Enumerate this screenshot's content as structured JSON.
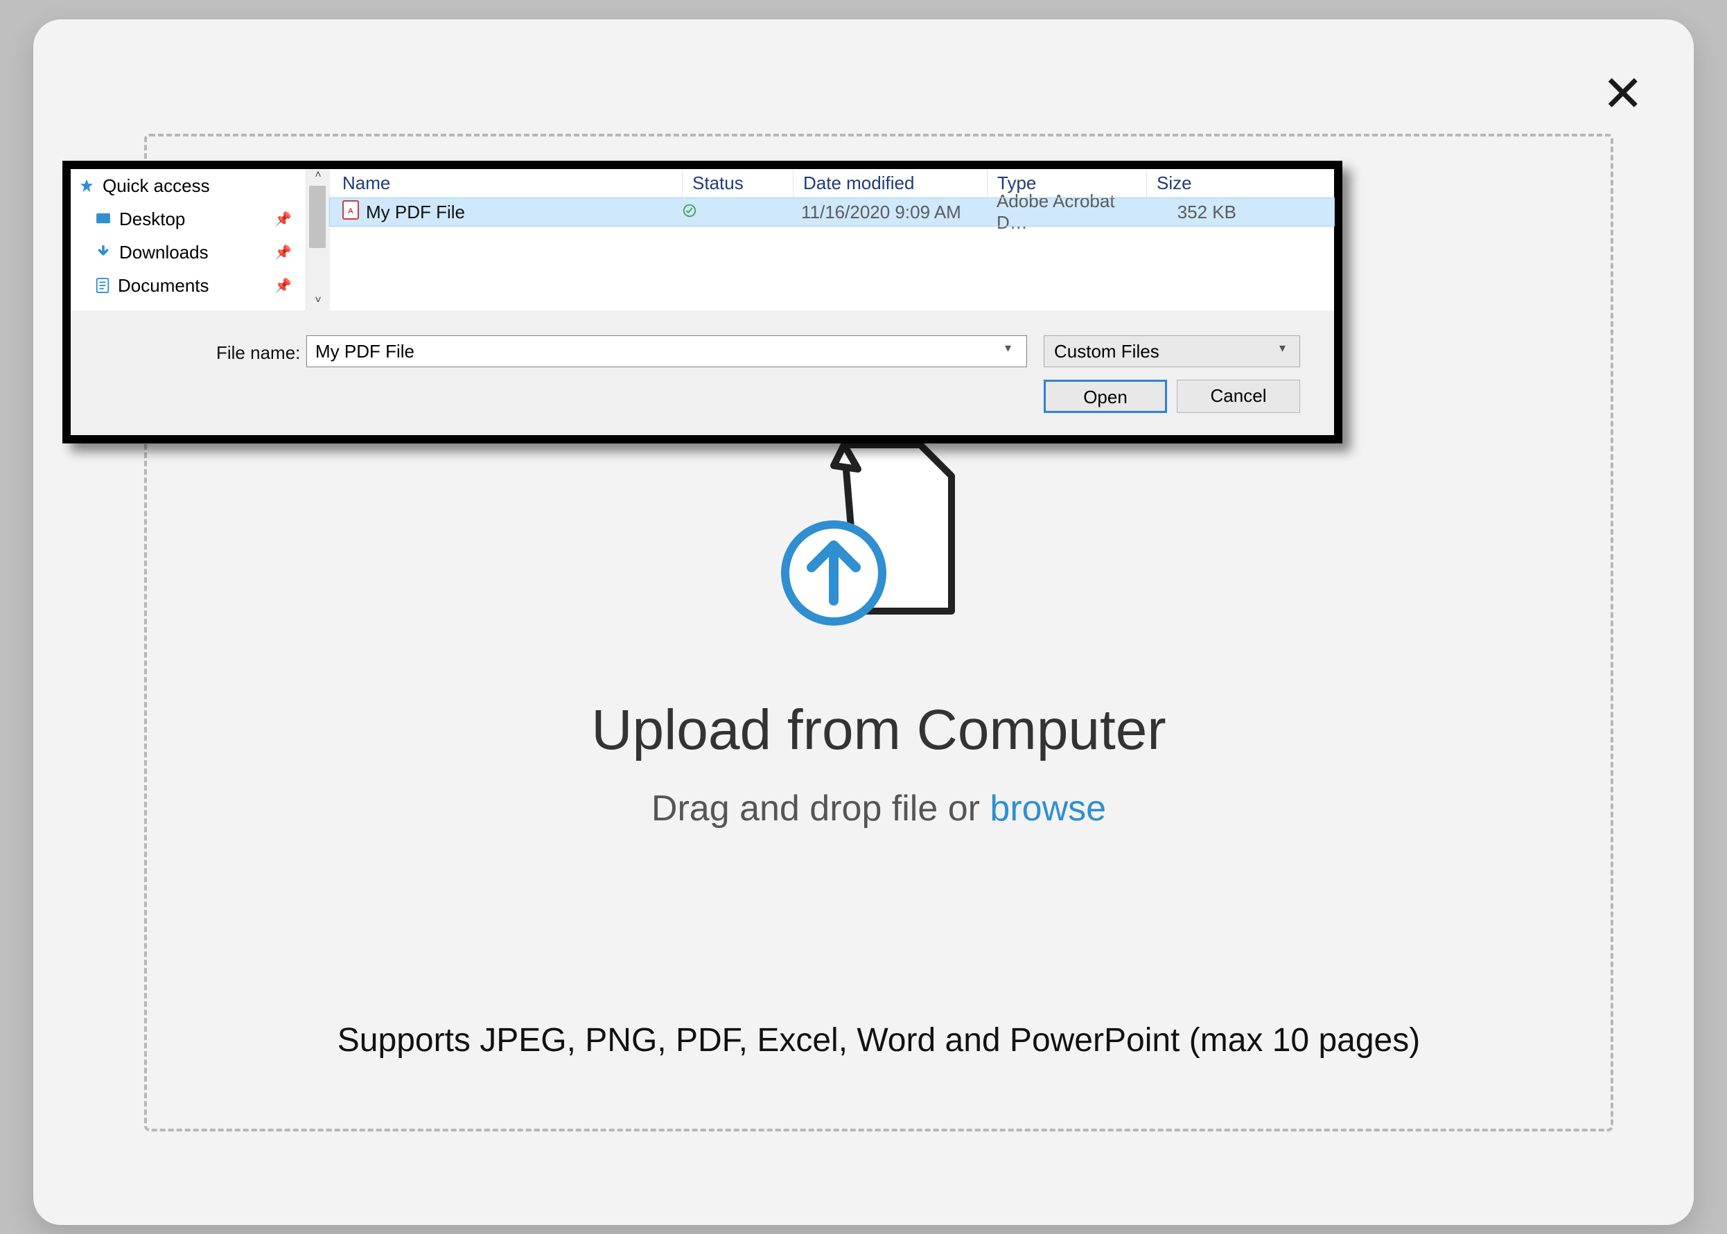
{
  "modal": {
    "headline": "Upload from Computer",
    "subline_prefix": "Drag and drop file or ",
    "subline_link": "browse",
    "supports": "Supports JPEG, PNG, PDF, Excel, Word and PowerPoint (max 10 pages)"
  },
  "picker": {
    "sidebar": {
      "quick_access": "Quick access",
      "items": [
        {
          "label": "Desktop",
          "icon": "desktop"
        },
        {
          "label": "Downloads",
          "icon": "download"
        },
        {
          "label": "Documents",
          "icon": "document"
        }
      ]
    },
    "columns": {
      "name": "Name",
      "status": "Status",
      "date": "Date modified",
      "type": "Type",
      "size": "Size"
    },
    "rows": [
      {
        "name": "My PDF File",
        "status_ok": true,
        "date": "11/16/2020 9:09 AM",
        "type": "Adobe Acrobat D…",
        "size": "352 KB",
        "selected": true
      }
    ],
    "file_name_label": "File name:",
    "file_name_value": "My PDF File",
    "filter_value": "Custom Files",
    "open_label": "Open",
    "cancel_label": "Cancel"
  }
}
